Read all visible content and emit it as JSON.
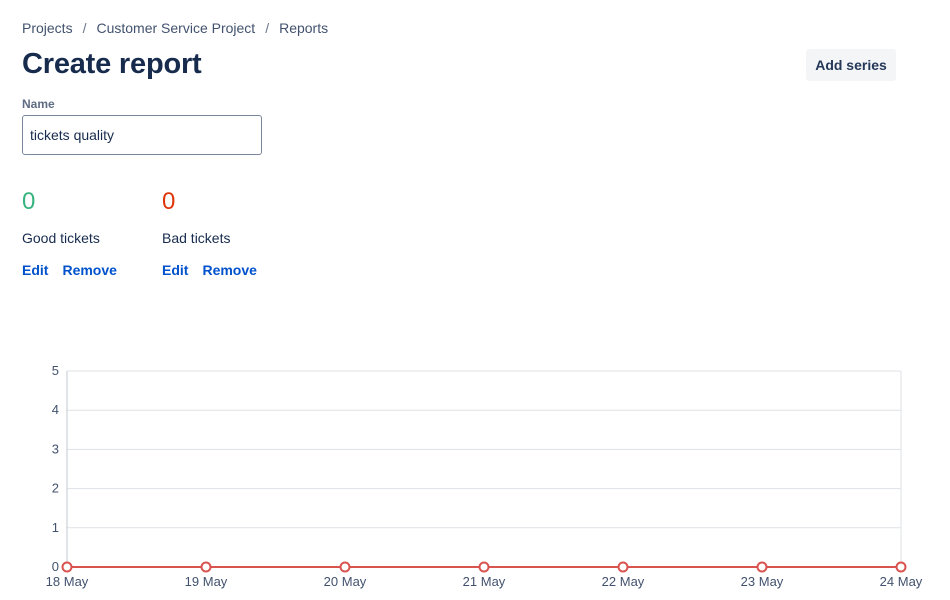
{
  "breadcrumb": {
    "items": [
      "Projects",
      "Customer Service Project",
      "Reports"
    ],
    "separator": "/"
  },
  "page": {
    "title": "Create report",
    "add_series_label": "Add series"
  },
  "name_field": {
    "label": "Name",
    "value": "tickets quality"
  },
  "series": [
    {
      "count": "0",
      "label": "Good tickets",
      "color": "#36b37e",
      "edit_label": "Edit",
      "remove_label": "Remove"
    },
    {
      "count": "0",
      "label": "Bad tickets",
      "color": "#de350b",
      "edit_label": "Edit",
      "remove_label": "Remove"
    }
  ],
  "chart_data": {
    "type": "line",
    "categories": [
      "18 May",
      "19 May",
      "20 May",
      "21 May",
      "22 May",
      "23 May",
      "24 May"
    ],
    "y_ticks": [
      "0",
      "1",
      "2",
      "3",
      "4",
      "5"
    ],
    "ylim": [
      0,
      5
    ],
    "grid": true,
    "series": [
      {
        "color": "#36b37e",
        "values": [
          0,
          0,
          0,
          0,
          0,
          0,
          0
        ]
      },
      {
        "color": "#d9534f",
        "values": [
          0,
          0,
          0,
          0,
          0,
          0,
          0
        ]
      }
    ]
  }
}
